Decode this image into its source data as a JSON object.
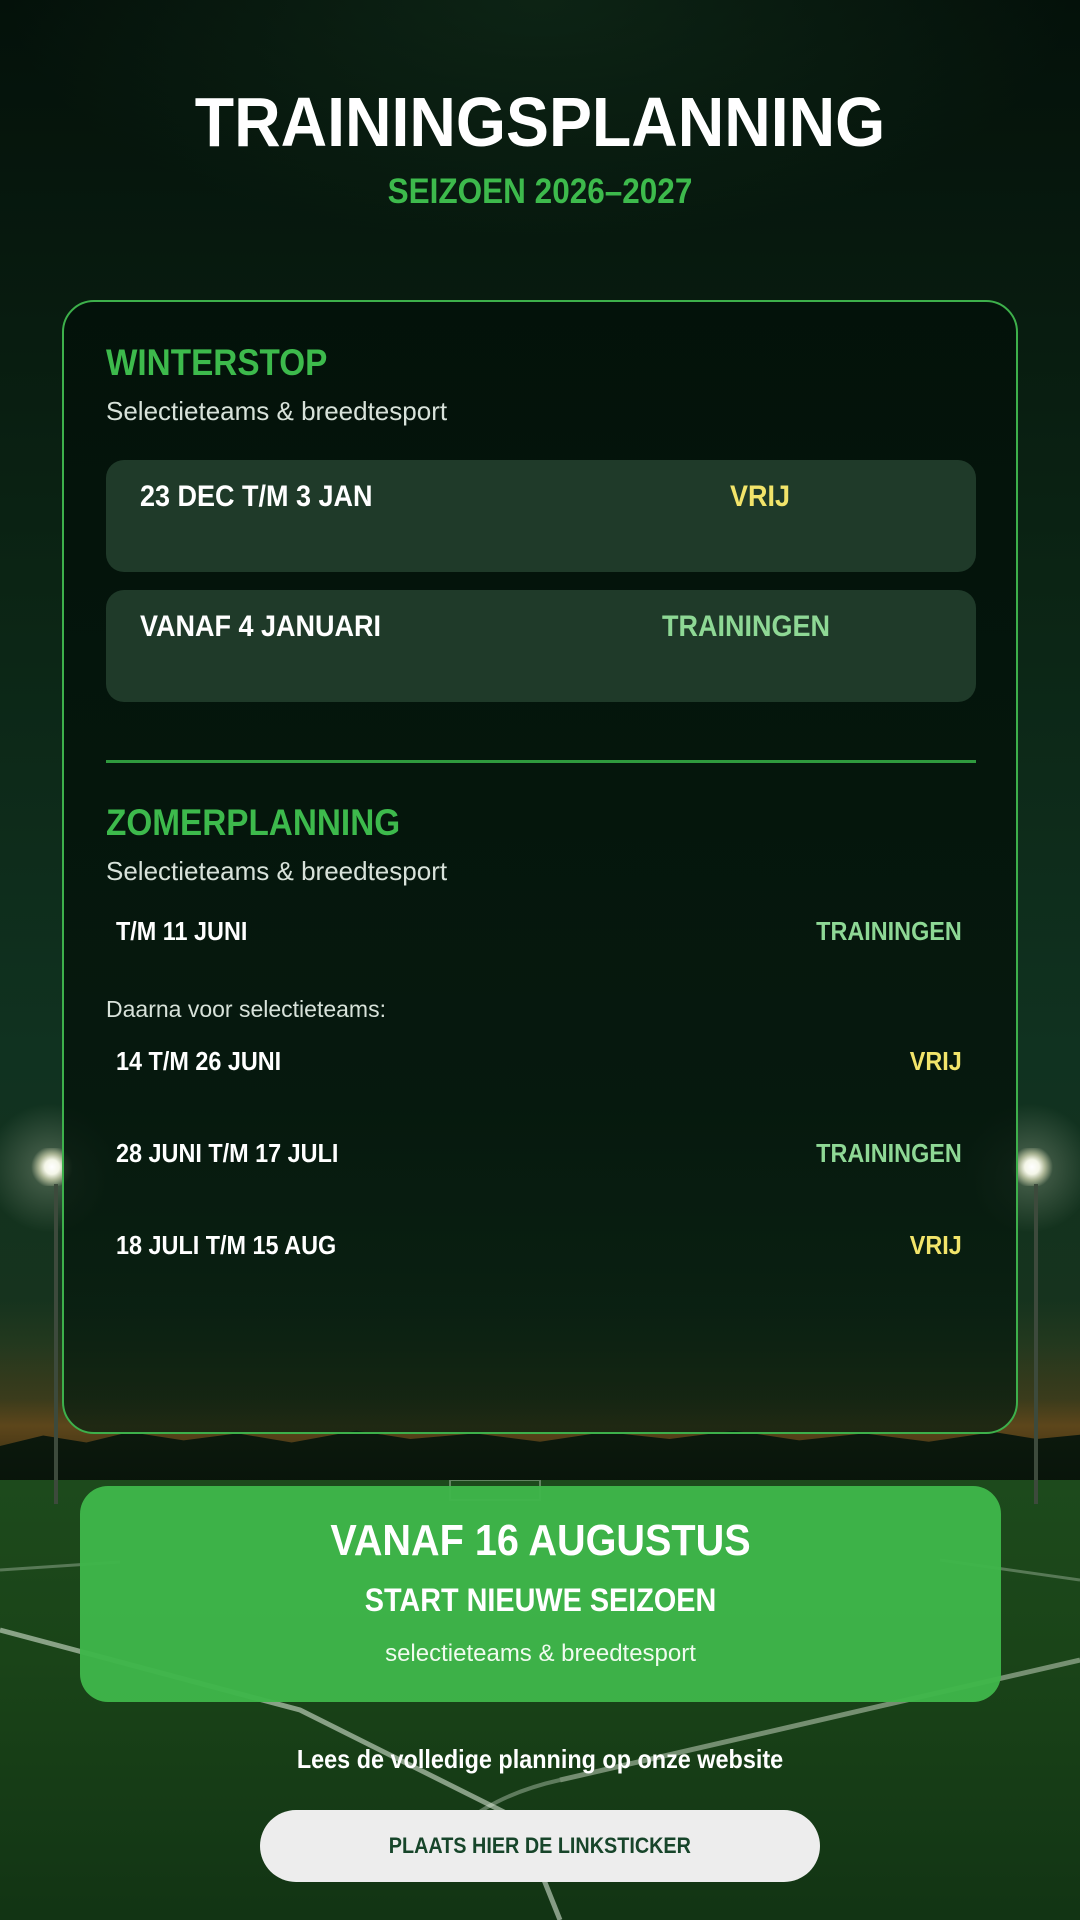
{
  "header": {
    "title": "TRAININGSPLANNING",
    "season": "SEIZOEN 2026–2027"
  },
  "winterstop": {
    "title": "WINTERSTOP",
    "subtitle": "Selectieteams & breedtesport",
    "periods": [
      {
        "date": "23 DEC T/M 3 JAN",
        "status": "VRIJ"
      },
      {
        "date": "VANAF 4 JANUARI",
        "status": "TRAININGEN"
      }
    ]
  },
  "zomerplanning": {
    "title": "ZOMERPLANNING",
    "subtitle": "Selectieteams & breedtesport",
    "first_period": {
      "date": "T/M 11 JUNI",
      "status": "TRAININGEN"
    },
    "note": "Daarna voor selectieteams:",
    "periods": [
      {
        "date": "14 T/M 26 JUNI",
        "status": "VRIJ"
      },
      {
        "date": "28 JUNI T/M 17 JULI",
        "status": "TRAININGEN"
      },
      {
        "date": "18 JULI T/M 15 AUG",
        "status": "VRIJ"
      }
    ]
  },
  "start_banner": {
    "date": "VANAF 16 AUGUSTUS",
    "headline": "START NIEUWE SEIZOEN",
    "subtitle": "selectieteams & breedtesport"
  },
  "footer": {
    "text": "Lees de volledige planning op onze website",
    "link_label": "PLAATS HIER DE LINKSTICKER"
  },
  "colors": {
    "accent_green": "#3dba4c",
    "vrij": "#f2e46a",
    "trainingen": "#8ed895",
    "banner": "#3eb64a"
  }
}
